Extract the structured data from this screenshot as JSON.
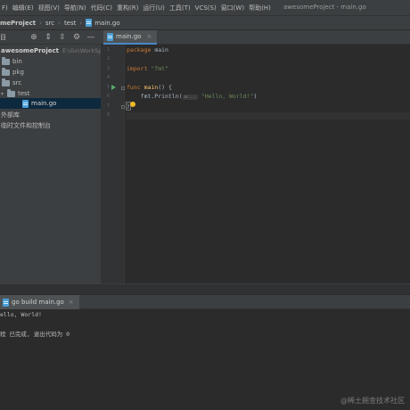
{
  "menu": {
    "items": [
      "F)",
      "编辑(E)",
      "视图(V)",
      "导航(N)",
      "代码(C)",
      "重构(R)",
      "运行(U)",
      "工具(T)",
      "VCS(S)",
      "窗口(W)",
      "帮助(H)"
    ],
    "window_title": "awesomeProject - main.go"
  },
  "breadcrumbs": [
    "meProject",
    "src",
    "test",
    "main.go"
  ],
  "project_panel": {
    "label": "目",
    "root_name": "awesomeProject",
    "root_path": "E:\\Go\\WorkSpac",
    "items": [
      {
        "label": "bin"
      },
      {
        "label": "pkg"
      },
      {
        "label": "src"
      },
      {
        "label": "test"
      },
      {
        "label": "main.go"
      },
      {
        "label": "外部库"
      },
      {
        "label": "临时文件和控制台"
      }
    ]
  },
  "editor": {
    "tab_label": "main.go",
    "line_numbers": [
      "1",
      "2",
      "3",
      "4",
      "5",
      "6",
      "7",
      "8"
    ],
    "code": {
      "l1_kw": "package",
      "l1_rest": " main",
      "l3_kw": "import",
      "l3_str": " \"fmt\"",
      "l5_kw": "func",
      "l5_fn": " main",
      "l5_rest": "() {",
      "l6_pre": "    fmt.Println(",
      "l6_hint": "a...",
      "l6_str": " \"Hello, World!\"",
      "l6_post": ")",
      "l7": "}"
    }
  },
  "run_panel": {
    "tab_label": "go build main.go",
    "output": [
      "ello, World!",
      "",
      "程 已完成, 退出代码为 0"
    ]
  },
  "watermark": "@稀土掘金技术社区",
  "colors": {
    "keyword": "#cc7832",
    "string": "#6a8759",
    "function": "#ffc66d",
    "selection": "#0d293e",
    "accent": "#4a88c7"
  }
}
